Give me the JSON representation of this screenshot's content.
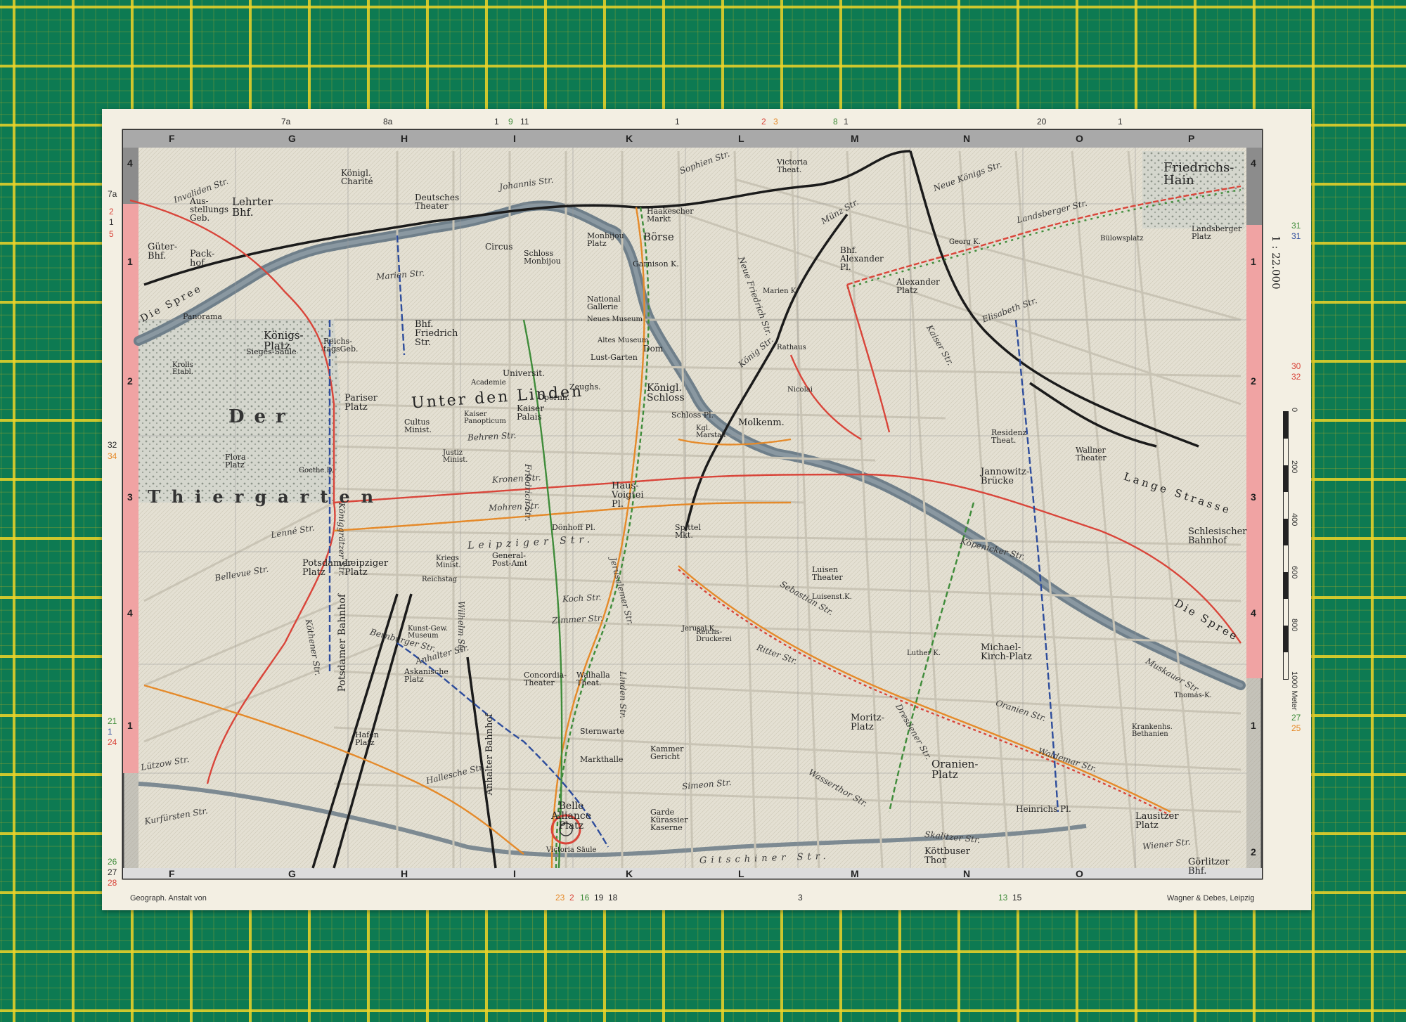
{
  "grid": {
    "columns_top": [
      "F",
      "G",
      "H",
      "I",
      "K",
      "L",
      "M",
      "N",
      "O",
      "P"
    ],
    "columns_bottom": [
      "F",
      "G",
      "H",
      "I",
      "K",
      "L",
      "M",
      "N",
      "O"
    ],
    "rows_left": [
      "4",
      "1",
      "2",
      "3",
      "4",
      "1"
    ],
    "rows_right": [
      "4",
      "1",
      "2",
      "3",
      "4",
      "1",
      "2"
    ]
  },
  "scale": {
    "label": "1 : 22.000",
    "ticks": [
      "0",
      "200",
      "400",
      "600",
      "800",
      "1000 Meter"
    ]
  },
  "credits": {
    "left": "Geograph. Anstalt von",
    "right": "Wagner & Debes, Leipzig"
  },
  "areas": {
    "der": "Der",
    "thiergarten": "Thiergarten",
    "unter_den_linden": "Unter den Linden"
  },
  "places": {
    "friedrichshain": "Friedrichs-Hain",
    "charite": "Königl. Charité",
    "lehrter_bhf": "Lehrter Bhf.",
    "ausstellungs_geb": "Aus-stellungs Geb.",
    "gueter_bhf": "Güter-Bhf.",
    "packhof": "Pack-hof",
    "koenigsplatz": "Königs-Platz",
    "siegessaeule": "Sieges-Säule",
    "reichstag": "Reichs-tagsGeb.",
    "deutsches_theater": "Deutsches Theater",
    "circus": "Circus",
    "schloss_monbijou": "Schloss Monbijou",
    "monbijou_platz": "Monbijou Platz",
    "haakescher_markt": "Haakescher Markt",
    "boerse": "Börse",
    "garnison": "Garnison K.",
    "bhf_friedrichstr": "Bhf. Friedrich Str.",
    "national_gallerie": "National Gallerie",
    "neues_museum": "Neues Museum",
    "altes_museum": "Altes Museum",
    "lustgarten": "Lust-Garten",
    "dom": "Dom",
    "universitaet": "Universit.",
    "akademie": "Academie",
    "opernhaus": "Opernh.",
    "zeughaus": "Zeughs.",
    "koenigl_schloss": "Königl. Schloss",
    "schlossplatz": "Schloss Pl.",
    "marstall": "Kgl. Marstall",
    "molkenmarkt": "Molkenm.",
    "bhf_alexanderplatz": "Bhf. Alexander Pl.",
    "alexanderplatz": "Alexander Platz",
    "victoria_theater": "Victoria Theat.",
    "pariser_platz": "Pariser Platz",
    "kaiser_palais": "Kaiser Palais",
    "kaiser_panopticum": "Kaiser Panopticum",
    "cultus_minist": "Cultus Minist.",
    "justiz_minist": "Justiz Minist.",
    "flora_platz": "Flora Platz",
    "goethe": "Goethe D.",
    "hausvoigtei_pl": "Haus-Voigtei Pl.",
    "spittel_markt": "Spittel Mkt.",
    "doenhoff_platz": "Dönhoff Pl.",
    "potsdamer_platz": "Potsdamer Platz",
    "leipziger_platz": "Leipziger Platz",
    "potsdamer_bahnhof": "Potsdamer Bahnhof",
    "anhalter_bahnhof": "Anhalter Bahnhof",
    "askanischer_platz": "Askanische Platz",
    "hafenplatz": "Hafen Platz",
    "general_post_amt": "General-Post-Amt",
    "kriegs_minist": "Kriegs Minist.",
    "reichstag_alt": "Reichstag",
    "kunst_gew_museum": "Kunst-Gew. Museum",
    "concordia_theater": "Concordia-Theater",
    "walhalla_theat": "Walhalla Theat.",
    "sternwarte": "Sternwarte",
    "markthalle": "Markthalle",
    "kammer_gericht": "Kammer Gericht",
    "belle_alliance_platz": "Belle Alliance Platz",
    "victoria_saeule": "Victoria Säule",
    "garde_kurassier_kaserne": "Garde Kürassier Kaserne",
    "reichs_druckerei": "Reichs-Druckerei",
    "jerusalem_k": "Jerusal.K.",
    "moritzplatz": "Moritz-Platz",
    "oranienplatz": "Oranien-Platz",
    "luisen_theater": "Luisen Theater",
    "luisenst_k": "Luisenst.K.",
    "michael_kirch_platz": "Michael-Kirch-Platz",
    "heinrichs_pl": "Heinrichs Pl.",
    "koettbuser_thor": "Köttbuser Thor",
    "lausitzer_platz": "Lausitzer Platz",
    "goerlitzer_bhf": "Görlitzer Bhf.",
    "schlesischer_bahnhof": "Schlesischer Bahnhof",
    "jannowitz_bruecke": "Jannowitz-Brücke",
    "wallner_theater": "Wallner Theater",
    "residenz_theat": "Residenz Theat.",
    "bethanien": "Krankenhs. Bethanien",
    "thomas_k": "Thomas-K.",
    "luther_k": "Luther K.",
    "landsberger_platz": "Landsberger Platz",
    "buelows_platz": "Bülowsplatz",
    "georg_k": "Georg K.",
    "marien_k": "Marien K.",
    "nicolai": "Nicolai",
    "rathaus": "Rathaus",
    "lange_strasse": "Lange Strasse",
    "die_spree": "Die Spree",
    "die_spree_west": "Die Spree",
    "panorama": "Panorama",
    "kroll": "Krolls Etabl."
  },
  "streets": {
    "invalidenstr": "Invaliden Str.",
    "johannisstr": "Johannis Str.",
    "friedrichstr": "Friedrich Str.",
    "leipzigerstr": "Leipziger Str.",
    "koeniggraetzer": "Königgrätzer Str.",
    "wilhelmstr": "Wilhelm Str.",
    "lindenstr": "Linden Str.",
    "oranienstr": "Oranien Str.",
    "koepenickerstr": "Köpenicker Str.",
    "skalitzerstr": "Skalitzer Str.",
    "wienerstr": "Wiener Str.",
    "koenigstr": "König Str.",
    "neue_friedrichstr": "Neue Friedrich Str.",
    "muenzstr": "Münz Str.",
    "landsbergerstr": "Landsberger Str.",
    "greifswalder": "Neue Königs Str.",
    "bernburger": "Bernburger Str.",
    "koethener": "Köthener Str.",
    "hallesche": "Hallesche Str.",
    "gitschiner": "Gitschiner Str.",
    "kurfuerstenstr": "Kurfürsten Str.",
    "lutzowstr": "Lützow Str.",
    "marienstr": "Marien Str.",
    "behrenstr": "Behren Str.",
    "mohrenstr": "Mohren Str.",
    "kronenstr": "Kronen Str.",
    "jerusalemer": "Jerusalemer Str.",
    "ritterstr": "Ritter Str.",
    "wassertorstr": "Wasserthor Str.",
    "waldemarstr": "Waldemar Str.",
    "muskauerstr": "Muskauer Str.",
    "dresdenerstr": "Dresdener Str.",
    "sebastianstr": "Sebastian Str.",
    "simeonstr": "Simeon Str.",
    "zimmerstr": "Zimmer Str.",
    "kochstr": "Koch Str.",
    "anhalterstr": "Anhalter Str.",
    "lennestr": "Lenné Str.",
    "bellevuestr": "Bellevue Str.",
    "sophienstr": "Sophien Str.",
    "elisabethstr": "Elisabeth Str.",
    "kaiserstr": "Kaiser Str."
  },
  "route_numbers": {
    "top": [
      "7a",
      "8a",
      "1",
      "9",
      "11",
      "1",
      "2",
      "3",
      "8",
      "1",
      "20",
      "1"
    ],
    "left": [
      "7a",
      "2",
      "1",
      "5",
      "32",
      "34",
      "21",
      "1",
      "24",
      "26",
      "27",
      "28"
    ],
    "right": [
      "31",
      "31",
      "30",
      "32",
      "27",
      "25"
    ],
    "bottom": [
      "23",
      "2",
      "16",
      "19",
      "18",
      "3",
      "13",
      "15"
    ]
  },
  "colors": {
    "paper": "#f3efe3",
    "mat": "#0d7a52",
    "mat_grid": "#e6cf2b",
    "water": "#6f7f8a",
    "park": "#bfc4bb",
    "street": "#c9c4b5",
    "route_red": "#d9453a",
    "route_orange": "#e58a2a",
    "route_green": "#3f8c3a",
    "route_blue": "#2e4d9c",
    "rail_black": "#1b1b1b",
    "border_pink": "#f0a3a3",
    "border_grey": "#8c8c8c"
  }
}
